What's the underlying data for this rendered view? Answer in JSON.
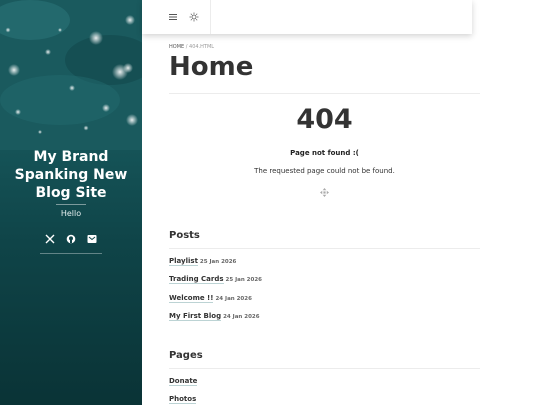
{
  "sidebar": {
    "brand": "My Brand Spanking New Blog Site",
    "tagline": "Hello",
    "socials": [
      {
        "icon": "x-icon"
      },
      {
        "icon": "github-icon"
      },
      {
        "icon": "email-icon"
      }
    ]
  },
  "topbar": {
    "menu_icon": "hamburger-icon",
    "theme_icon": "sun-icon"
  },
  "breadcrumb": {
    "home": "HOME",
    "current": "/ 404.HTML"
  },
  "page": {
    "title": "Home"
  },
  "error": {
    "code": "404",
    "heading": "Page not found :(",
    "message": "The requested page could not be found.",
    "icon": "move-arrows-icon"
  },
  "posts": {
    "title": "Posts",
    "items": [
      {
        "title": "Playlist",
        "date": "25 Jan 2026"
      },
      {
        "title": "Trading Cards",
        "date": "25 Jan 2026"
      },
      {
        "title": "Welcome !!",
        "date": "24 Jan 2026"
      },
      {
        "title": "My First Blog",
        "date": "24 Jan 2026"
      }
    ]
  },
  "pages": {
    "title": "Pages",
    "items": [
      {
        "title": "Donate"
      },
      {
        "title": "Photos"
      }
    ]
  }
}
